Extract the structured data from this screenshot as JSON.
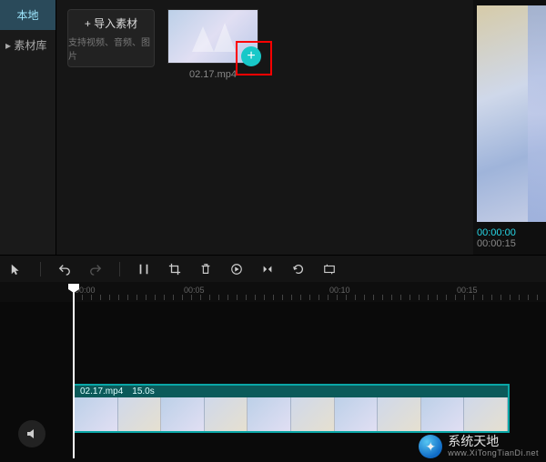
{
  "sidebar": {
    "active_tab": "本地",
    "library_label": "素材库"
  },
  "import_card": {
    "title": "导入素材",
    "plus": "+",
    "subtitle": "支持视频、音频、图片"
  },
  "clip": {
    "filename": "02.17.mp4",
    "add_glyph": "+"
  },
  "preview": {
    "current_time": "00:00:00",
    "total_time": "00:00:15"
  },
  "ruler": {
    "ticks": [
      "00:00",
      "00:05",
      "00:10",
      "00:15"
    ]
  },
  "timeline_clip": {
    "filename": "02.17.mp4",
    "duration": "15.0s"
  },
  "watermark": {
    "cn": "系统天地",
    "en": "www.XiTongTianDi.net"
  }
}
